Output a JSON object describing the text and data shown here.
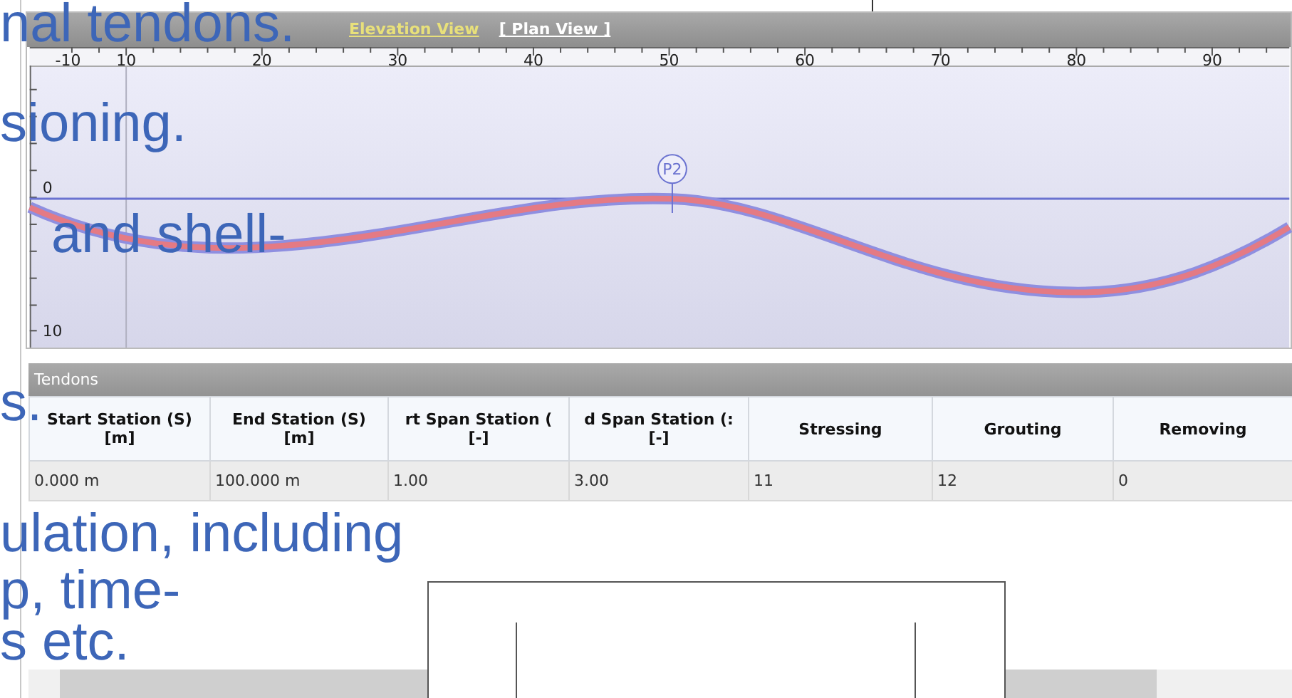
{
  "view_panel": {
    "tabs": [
      {
        "label": "Elevation View",
        "selected": true
      },
      {
        "label": "[ Plan View ]",
        "selected": false
      }
    ],
    "x_ticks": [
      "-10",
      "10",
      "20",
      "30",
      "40",
      "50",
      "60",
      "70",
      "80",
      "90"
    ],
    "y_ticks": [
      "0",
      "10"
    ],
    "point_label": "P2"
  },
  "tendons_panel": {
    "title": "Tendons",
    "columns": [
      {
        "line1": "Start Station (S)",
        "line2": "[m]"
      },
      {
        "line1": "End Station (S)",
        "line2": "[m]"
      },
      {
        "line1": "rt Span Station (",
        "line2": "[-]"
      },
      {
        "line1": "d Span Station (:",
        "line2": "[-]"
      },
      {
        "line1": "Stressing"
      },
      {
        "line1": "Grouting"
      },
      {
        "line1": "Removing"
      }
    ],
    "rows": [
      [
        "0.000 m",
        "100.000 m",
        "1.00",
        "3.00",
        "11",
        "12",
        "0"
      ]
    ]
  },
  "overlay_text": [
    "nal tendons.",
    "sioning.",
    "and shell-",
    "s.",
    "ulation, including",
    "p, time-",
    "s etc."
  ]
}
